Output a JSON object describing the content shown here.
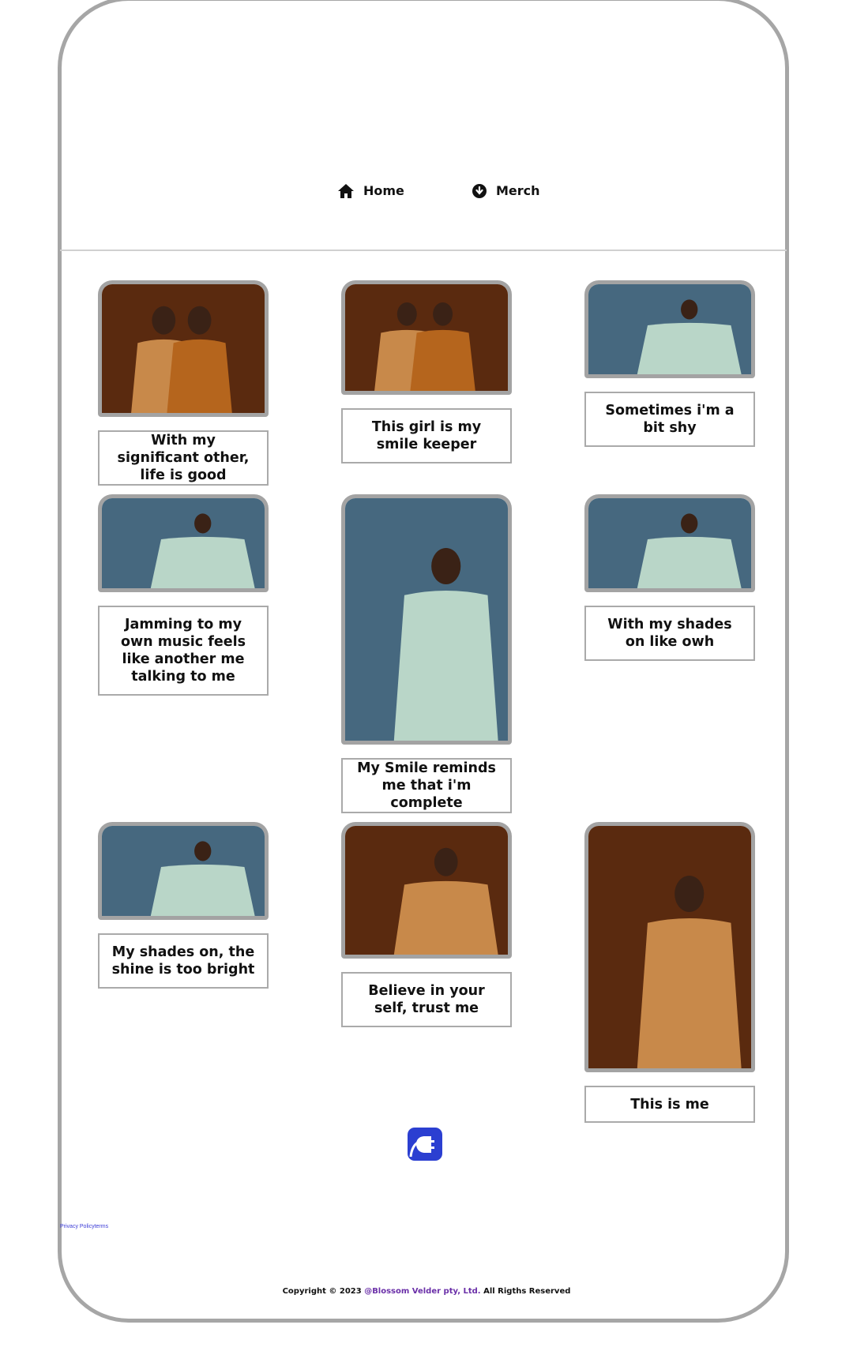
{
  "nav": {
    "home_label": "Home",
    "merch_label": "Merch"
  },
  "gallery": [
    {
      "caption": "With my significant other, life is good",
      "bg": "#5a2a0f",
      "people": 2
    },
    {
      "caption": "This girl is my smile keeper",
      "bg": "#5a2a0f",
      "people": 2
    },
    {
      "caption": "Sometimes i'm a bit shy",
      "bg": "#46687f",
      "people": 1
    },
    {
      "caption": "Jamming to my own music feels like another me talking to me",
      "bg": "#46687f",
      "people": 1
    },
    {
      "caption": "My Smile reminds me that i'm complete",
      "bg": "#46687f",
      "people": 1
    },
    {
      "caption": "With my shades on like owh",
      "bg": "#46687f",
      "people": 1
    },
    {
      "caption": "My shades on, the shine is too bright",
      "bg": "#46687f",
      "people": 1
    },
    {
      "caption": "Believe in your self, trust me",
      "bg": "#5a2a0f",
      "people": 1
    },
    {
      "caption": "This is me",
      "bg": "#5a2a0f",
      "people": 1
    }
  ],
  "footer": {
    "privacy_link": "Privacy Policyterms",
    "copyright_prefix": "Copyright © 2023 ",
    "brand": "@Blossom Velder pty, Ltd.",
    "copyright_suffix": " All Rigths Reserved"
  },
  "colors": {
    "brand_logo": "#2b3fd1",
    "frame_border": "#a6a6a6"
  }
}
